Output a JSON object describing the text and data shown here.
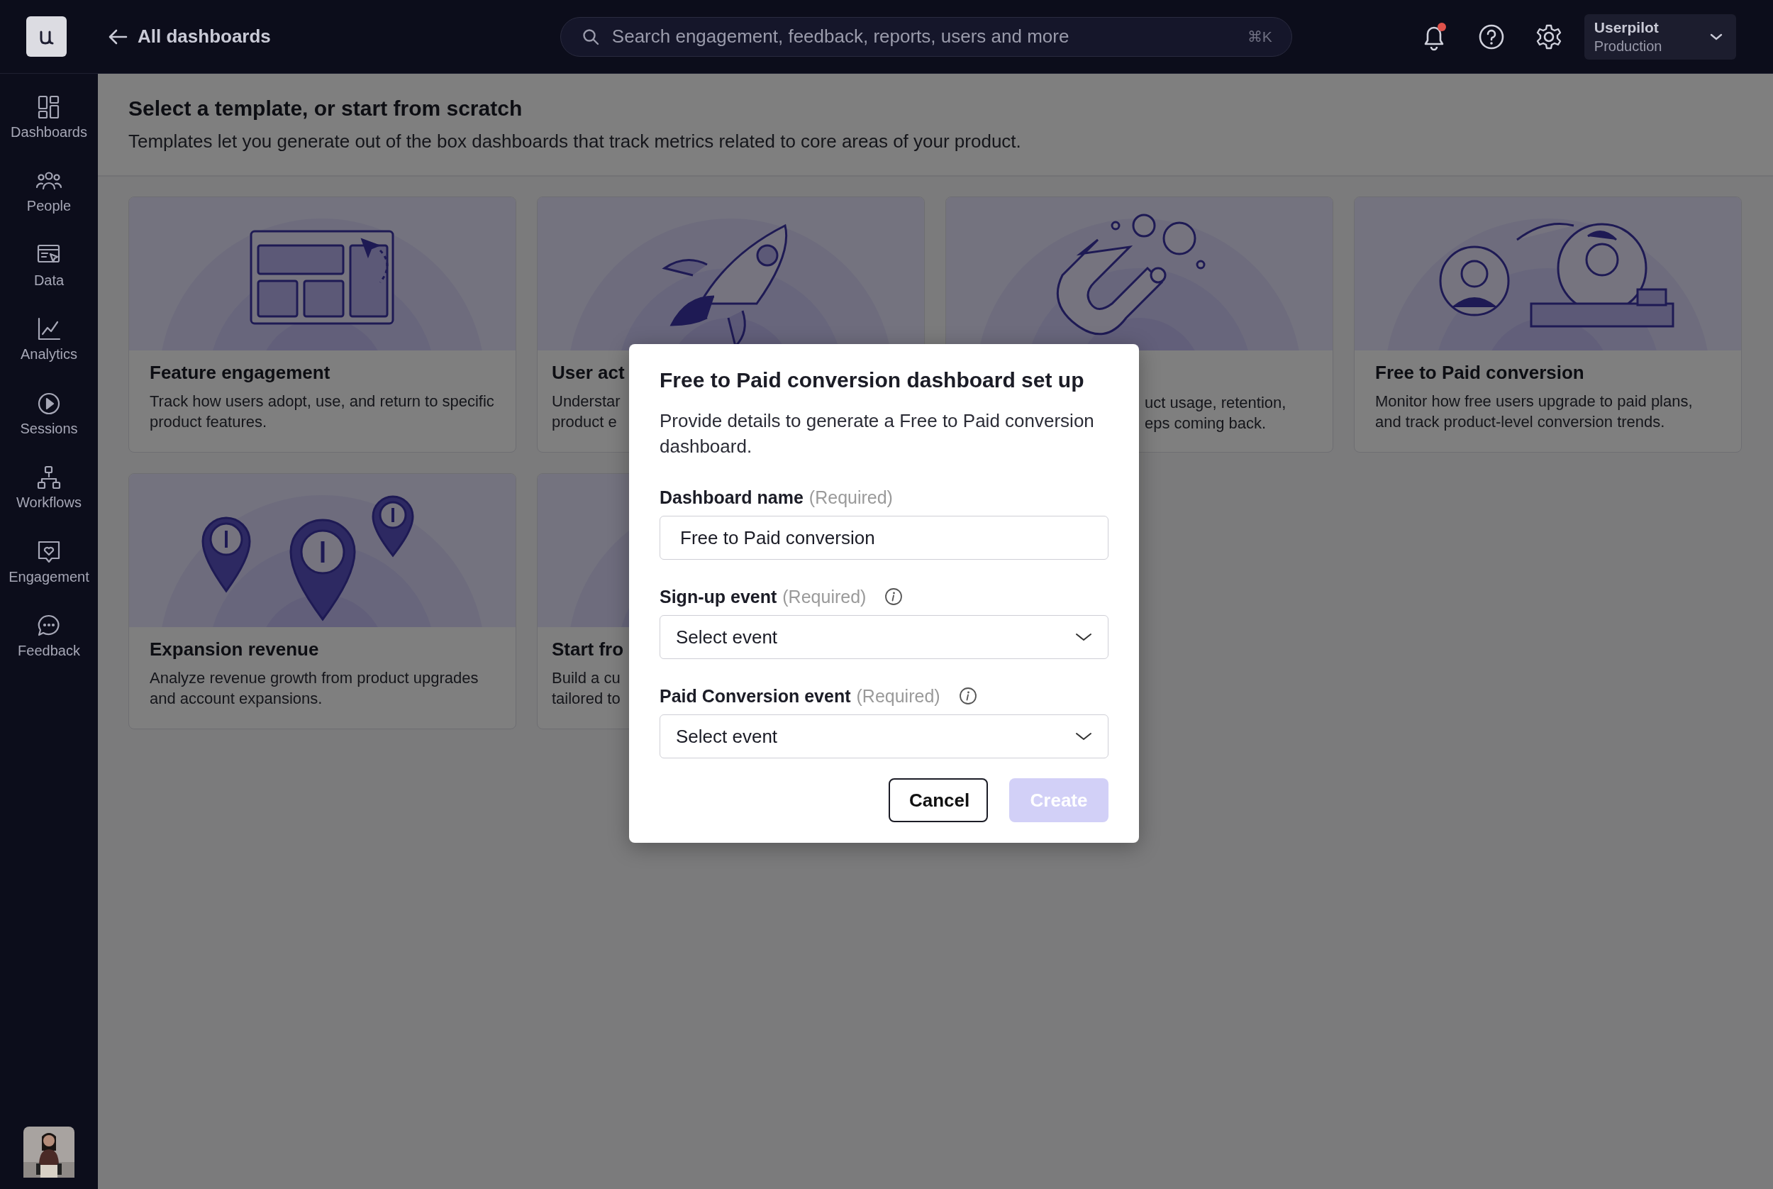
{
  "topbar": {
    "back_link": "All dashboards",
    "search": {
      "placeholder": "Search engagement, feedback, reports, users and more",
      "shortcut": "⌘K"
    },
    "notification_dot": true,
    "account": {
      "name": "Userpilot",
      "environment": "Production"
    }
  },
  "sidebar": {
    "items": [
      {
        "label": "Dashboards"
      },
      {
        "label": "People"
      },
      {
        "label": "Data"
      },
      {
        "label": "Analytics"
      },
      {
        "label": "Sessions"
      },
      {
        "label": "Workflows"
      },
      {
        "label": "Engagement"
      },
      {
        "label": "Feedback"
      }
    ]
  },
  "header": {
    "title": "Select a template, or start from scratch",
    "subtitle": "Templates let you generate out of the box dashboards that track metrics related to core areas of your product."
  },
  "cards": [
    {
      "kind": "full",
      "title": "Feature engagement",
      "description": "Track how users adopt, use, and return to specific product features."
    },
    {
      "kind": "cut_right",
      "title": "User act",
      "description_lines": [
        "Understar",
        "product e"
      ]
    },
    {
      "kind": "cut_left",
      "description_lines": [
        "uct usage, retention,",
        "eps coming back."
      ]
    },
    {
      "kind": "full",
      "title": "Free to Paid conversion",
      "description": "Monitor how free users upgrade to paid plans, and track product-level conversion trends."
    },
    {
      "kind": "full",
      "title": "Expansion revenue",
      "description": "Analyze revenue growth from product upgrades and account expansions."
    },
    {
      "kind": "cut_right",
      "title": "Start fro",
      "description_lines": [
        "Build a cu",
        "tailored to"
      ]
    }
  ],
  "modal": {
    "title": "Free to Paid conversion dashboard set up",
    "description": "Provide details to generate a Free to Paid conversion dashboard.",
    "fields": [
      {
        "kind": "text",
        "label": "Dashboard name",
        "note": "(Required)",
        "info": false,
        "value": "Free to Paid conversion"
      },
      {
        "kind": "select",
        "label": "Sign-up event",
        "note": "(Required)",
        "info": true,
        "value": "Select event"
      },
      {
        "kind": "select",
        "label": "Paid Conversion event",
        "note": "(Required)",
        "info": true,
        "value": "Select event"
      }
    ],
    "buttons": [
      {
        "label": "Cancel",
        "kind": "secondary",
        "disabled": false
      },
      {
        "label": "Create",
        "kind": "primary",
        "disabled": true
      }
    ]
  }
}
